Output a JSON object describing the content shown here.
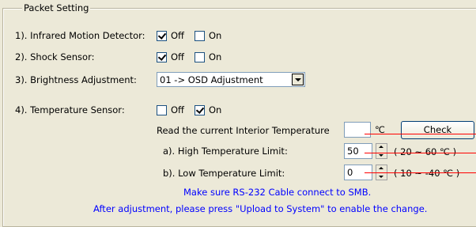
{
  "group_title": "Packet Setting",
  "rows": {
    "infrared": {
      "label": "1). Infrared Motion Detector:",
      "off_label": "Off",
      "on_label": "On",
      "off_checked": true,
      "on_checked": false
    },
    "shock": {
      "label": "2). Shock Sensor:",
      "off_label": "Off",
      "on_label": "On",
      "off_checked": true,
      "on_checked": false
    },
    "brightness": {
      "label": "3). Brightness Adjustment:",
      "selected": "01 -> OSD Adjustment"
    },
    "temperature": {
      "label": "4). Temperature Sensor:",
      "off_label": "Off",
      "on_label": "On",
      "off_checked": false,
      "on_checked": true
    }
  },
  "read_temp": {
    "label": "Read the current Interior Temperature",
    "value": "",
    "unit": "℃",
    "button": "Check"
  },
  "high_limit": {
    "label": "a). High Temperature Limit:",
    "value": "50",
    "range": "( 20 ~ 60 ℃ )"
  },
  "low_limit": {
    "label": "b). Low Temperature Limit:",
    "value": "0",
    "range": "( 10 ~ -40 ℃ )"
  },
  "notes": {
    "line1": "Make sure RS-232 Cable connect to SMB.",
    "line2": "After adjustment, please press \"Upload to System\" to enable the change."
  },
  "colors": {
    "note_text": "#0000ff",
    "annotation_lines": "#ff0000"
  }
}
